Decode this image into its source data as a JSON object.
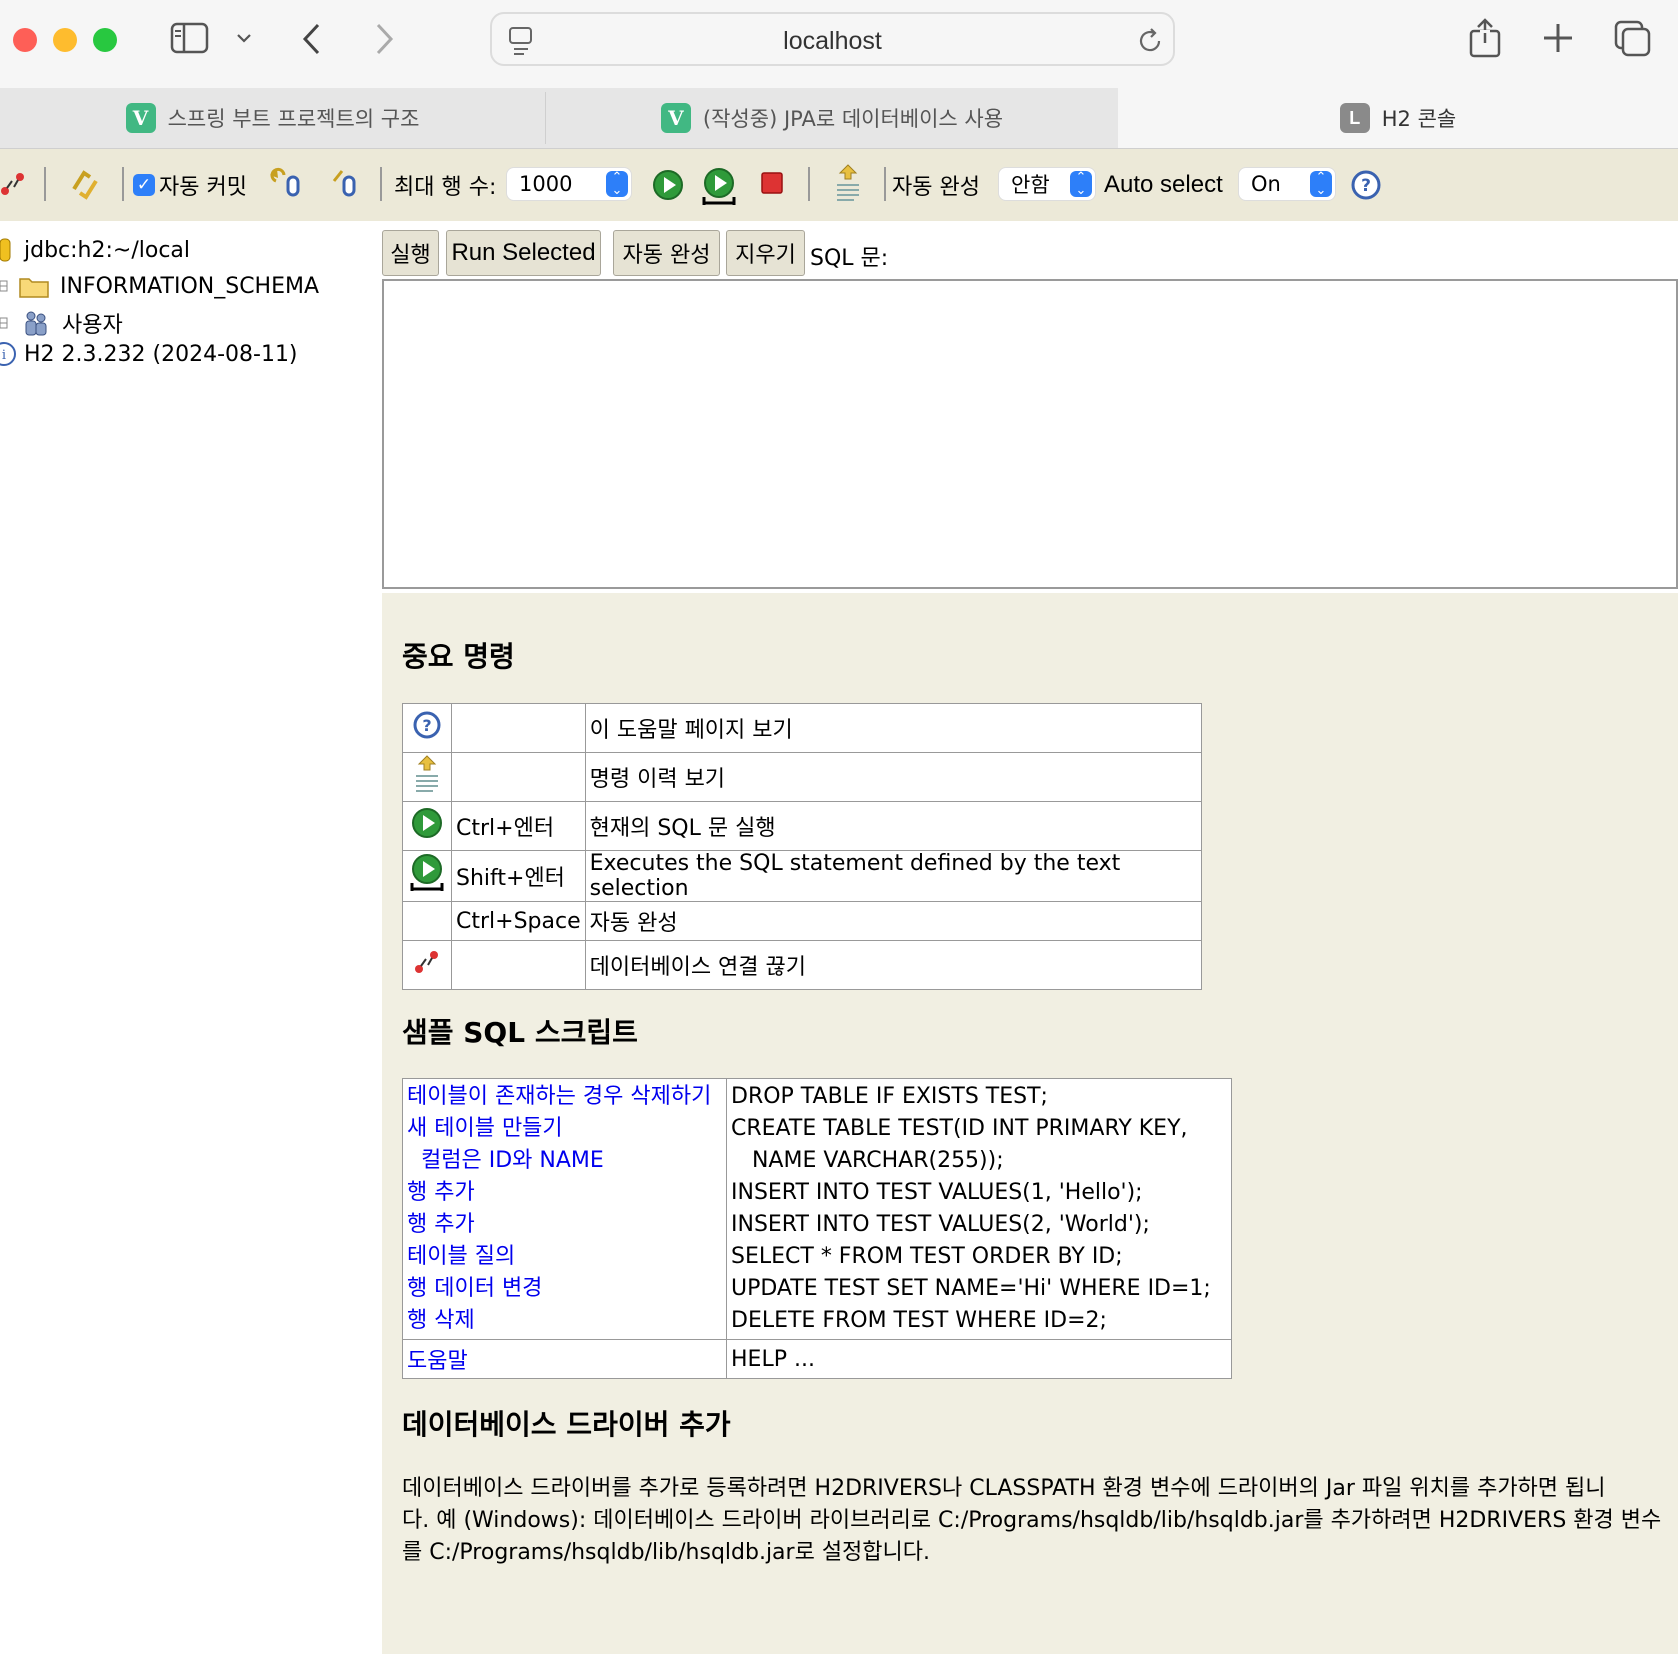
{
  "browser": {
    "url": "localhost",
    "tabs": [
      {
        "label": "스프링 부트 프로젝트의 구조",
        "favicon": "V"
      },
      {
        "label": "(작성중) JPA로 데이터베이스 사용",
        "favicon": "V"
      },
      {
        "label": "H2 콘솔",
        "favicon": "L"
      }
    ]
  },
  "toolbar": {
    "autocommit_label": "자동 커밋",
    "max_rows_label": "최대 행 수:",
    "max_rows_value": "1000",
    "autocomplete_label": "자동 완성",
    "autocomplete_value": "안함",
    "autoselect_label": "Auto select",
    "autoselect_value": "On"
  },
  "tree": {
    "connection": "jdbc:h2:~/local",
    "schema": "INFORMATION_SCHEMA",
    "users": "사용자",
    "version": "H2 2.3.232 (2024-08-11)"
  },
  "editor": {
    "run_label": "실행",
    "run_selected_label": "Run Selected",
    "autocomplete_label": "자동 완성",
    "clear_label": "지우기",
    "sql_label": "SQL 문:"
  },
  "help": {
    "important_title": "중요 명령",
    "commands": [
      {
        "icon": "help-icon",
        "shortcut": "",
        "desc": "이 도움말 페이지 보기"
      },
      {
        "icon": "history-icon",
        "shortcut": "",
        "desc": "명령 이력 보기"
      },
      {
        "icon": "run-icon",
        "shortcut": "Ctrl+엔터",
        "desc": "현재의 SQL 문 실행"
      },
      {
        "icon": "run-selected-icon",
        "shortcut": "Shift+엔터",
        "desc": "Executes the SQL statement defined by the text selection"
      },
      {
        "icon": "",
        "shortcut": "Ctrl+Space",
        "desc": "자동 완성"
      },
      {
        "icon": "disconnect-icon",
        "shortcut": "",
        "desc": "데이터베이스 연결 끊기"
      }
    ],
    "sample_title": "샘플 SQL 스크립트",
    "samples": [
      {
        "label": "테이블이 존재하는 경우 삭제하기",
        "sql": "DROP TABLE IF EXISTS TEST;"
      },
      {
        "label": "새 테이블 만들기",
        "sql": "CREATE TABLE TEST(ID INT PRIMARY KEY,"
      },
      {
        "label": "  컬럼은 ID와 NAME",
        "sql": "   NAME VARCHAR(255));"
      },
      {
        "label": "행 추가",
        "sql": "INSERT INTO TEST VALUES(1, 'Hello');"
      },
      {
        "label": "행 추가",
        "sql": "INSERT INTO TEST VALUES(2, 'World');"
      },
      {
        "label": "테이블 질의",
        "sql": "SELECT * FROM TEST ORDER BY ID;"
      },
      {
        "label": "행 데이터 변경",
        "sql": "UPDATE TEST SET NAME='Hi' WHERE ID=1;"
      },
      {
        "label": "행 삭제",
        "sql": "DELETE FROM TEST WHERE ID=2;"
      }
    ],
    "help_row": {
      "label": "도움말",
      "sql": "HELP ..."
    },
    "driver_title": "데이터베이스 드라이버 추가",
    "driver_lines": [
      "데이터베이스 드라이버를 추가로 등록하려면 H2DRIVERS나 CLASSPATH 환경 변수에 드라이버의 Jar 파일 위치를 추가하면 됩니",
      "다. 예 (Windows): 데이터베이스 드라이버 라이브러리로 C:/Programs/hsqldb/lib/hsqldb.jar를 추가하려면 H2DRIVERS 환경 변수",
      "를 C:/Programs/hsqldb/lib/hsqldb.jar로 설정합니다."
    ]
  }
}
